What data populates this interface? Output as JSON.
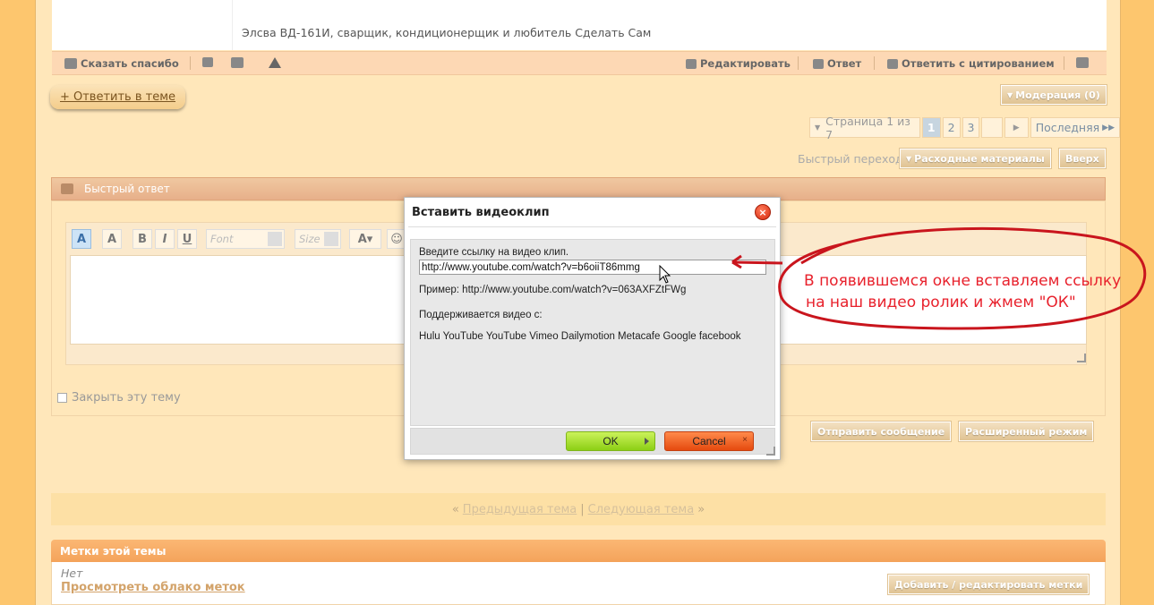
{
  "post": {
    "signature": "Элсва ВД-161И, сварщик, кондиционерщик и любитель Сделать Сам",
    "bar": {
      "thanks": "Сказать спасибо",
      "edit": "Редактировать",
      "reply": "Ответ",
      "reply_quote": "Ответить с цитированием"
    }
  },
  "actions": {
    "reply_topic": "+ Ответить в теме",
    "moderation": "Модерация (0)"
  },
  "pager": {
    "label": "Страница 1 из 7",
    "pages": [
      "1",
      "2",
      "3"
    ],
    "last": "Последняя"
  },
  "quick_nav": {
    "label": "Быстрый переход",
    "forum": "Расходные материалы",
    "top": "Вверх"
  },
  "quick_reply": {
    "title": "Быстрый ответ",
    "font_placeholder": "Font",
    "size_placeholder": "Size",
    "close_topic": "Закрыть эту тему",
    "send": "Отправить сообщение",
    "advanced": "Расширенный режим"
  },
  "topic_nav": {
    "left_quote": "«",
    "prev": "Предыдущая тема",
    "sep": "|",
    "next": "Следующая тема",
    "right_quote": "»"
  },
  "tags": {
    "title": "Метки этой темы",
    "none": "Нет",
    "cloud_link": "Просмотреть облако меток",
    "edit_button": "Добавить / редактировать метки"
  },
  "modal": {
    "title": "Вставить видеоклип",
    "prompt": "Введите ссылку на видео клип.",
    "url_value": "http://www.youtube.com/watch?v=b6oiiT86mmg",
    "example": "Пример: http://www.youtube.com/watch?v=063AXFZtFWg",
    "supported_label": "Поддерживается видео с:",
    "providers": "Hulu YouTube YouTube Vimeo Dailymotion Metacafe Google facebook",
    "ok": "OK",
    "cancel": "Cancel"
  },
  "annotation": {
    "line1": "В появившемся окне вставляем ссылку",
    "line2": "на наш видео ролик и жмем \"ОК\""
  }
}
